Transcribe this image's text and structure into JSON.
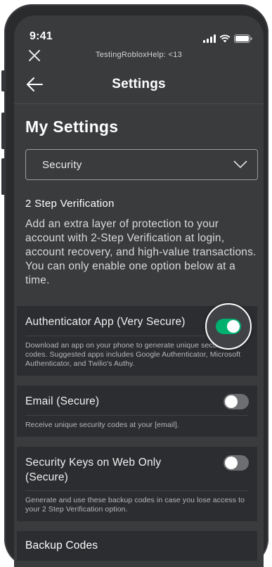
{
  "status": {
    "time": "9:41"
  },
  "window": {
    "title": "TestingRobloxHelp: <13"
  },
  "nav": {
    "title": "Settings"
  },
  "page": {
    "heading": "My Settings"
  },
  "dropdown": {
    "selected": "Security"
  },
  "two_step": {
    "title": "2 Step Verification",
    "description": "Add an extra layer of protection to your account with 2-Step Verification at login, account recovery, and high-value transactions. You can only enable one option below at a time."
  },
  "options": [
    {
      "title": "Authenticator App (Very Secure)",
      "description": "Download an app on your phone to generate unique security codes. Suggested apps includes Google Authenticator, Microsoft Authenticator, and Twilio's Authy.",
      "enabled": true
    },
    {
      "title": "Email (Secure)",
      "description": "Receive unique security codes at your [email].",
      "enabled": false
    },
    {
      "title": "Security Keys on Web Only (Secure)",
      "description": "Generate and use these backup codes in case you lose access to your 2 Step Verification option.",
      "enabled": false
    }
  ],
  "backup": {
    "title": "Backup Codes"
  },
  "colors": {
    "toggle_on": "#00b06f",
    "background": "#393b3d",
    "card": "#2c2d30"
  },
  "icons": [
    "close-icon",
    "back-arrow-icon",
    "chevron-down-icon",
    "signal-icon",
    "wifi-icon",
    "battery-icon"
  ]
}
